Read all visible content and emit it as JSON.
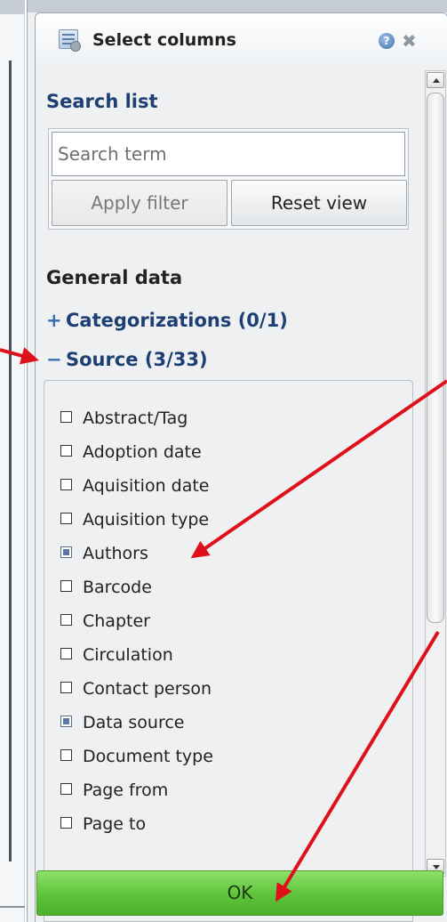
{
  "panel": {
    "title": "Select columns"
  },
  "search": {
    "heading": "Search list",
    "placeholder": "Search term",
    "apply_label": "Apply filter",
    "reset_label": "Reset view"
  },
  "groups": {
    "heading": "General data",
    "categorizations": {
      "symbol": "+",
      "label": "Categorizations (0/1)"
    },
    "source": {
      "symbol": "−",
      "label": "Source (3/33)"
    }
  },
  "source_items": [
    {
      "label": "Abstract/Tag",
      "checked": false
    },
    {
      "label": "Adoption date",
      "checked": false
    },
    {
      "label": "Aquisition date",
      "checked": false
    },
    {
      "label": "Aquisition type",
      "checked": false
    },
    {
      "label": "Authors",
      "checked": true
    },
    {
      "label": "Barcode",
      "checked": false
    },
    {
      "label": "Chapter",
      "checked": false
    },
    {
      "label": "Circulation",
      "checked": false
    },
    {
      "label": "Contact person",
      "checked": false
    },
    {
      "label": "Data source",
      "checked": true
    },
    {
      "label": "Document type",
      "checked": false
    },
    {
      "label": "Page from",
      "checked": false
    },
    {
      "label": "Page to",
      "checked": false
    }
  ],
  "footer": {
    "ok_label": "OK"
  },
  "colors": {
    "accent_blue": "#1d3f74",
    "ok_green": "#5cc33a",
    "annotation_red": "#e0101a"
  },
  "icons": {
    "tab": "column-settings-icon",
    "help": "help-icon",
    "close": "close-icon"
  }
}
